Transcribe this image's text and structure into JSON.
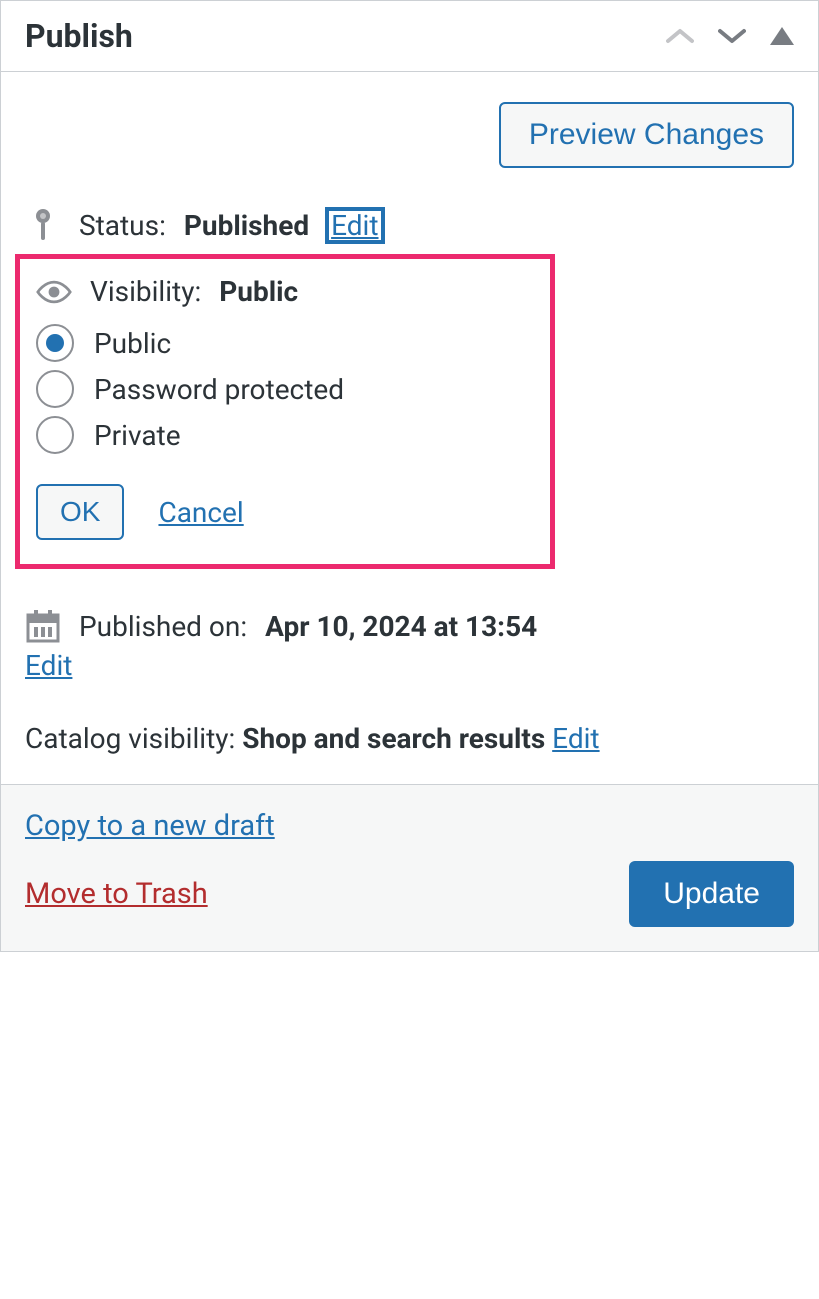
{
  "panel": {
    "title": "Publish"
  },
  "buttons": {
    "preview": "Preview Changes",
    "ok": "OK",
    "cancel": "Cancel",
    "update": "Update"
  },
  "status": {
    "label": "Status:",
    "value": "Published",
    "edit": "Edit"
  },
  "visibility": {
    "label": "Visibility:",
    "value": "Public",
    "options": [
      {
        "label": "Public",
        "selected": true
      },
      {
        "label": "Password protected",
        "selected": false
      },
      {
        "label": "Private",
        "selected": false
      }
    ]
  },
  "published": {
    "label": "Published on:",
    "value": "Apr 10, 2024 at 13:54",
    "edit": "Edit"
  },
  "catalog": {
    "label": "Catalog visibility:",
    "value": "Shop and search results",
    "edit": "Edit"
  },
  "footer": {
    "copy": "Copy to a new draft",
    "trash": "Move to Trash"
  }
}
